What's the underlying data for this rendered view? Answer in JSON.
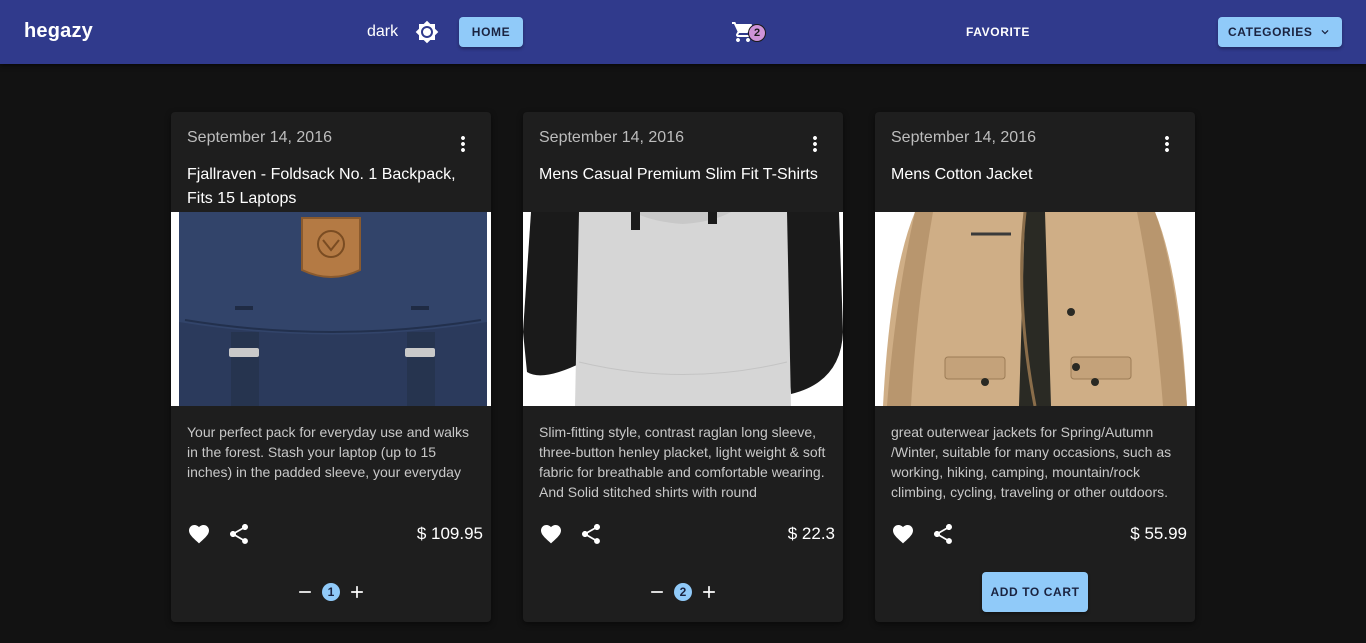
{
  "header": {
    "brand": "hegazy",
    "mode_label": "dark",
    "home_label": "HOME",
    "cart_count": "2",
    "favorite_label": "FAVORITE",
    "categories_label": "CATEGORIES"
  },
  "products": [
    {
      "date": "September 14, 2016",
      "title": "Fjallraven - Foldsack No. 1 Backpack, Fits 15 Laptops",
      "description": "Your perfect pack for everyday use and walks in the forest. Stash your laptop (up to 15 inches) in the padded sleeve, your everyday",
      "price": "$ 109.95",
      "quantity": "1"
    },
    {
      "date": "September 14, 2016",
      "title": "Mens Casual Premium Slim Fit T-Shirts",
      "description": "Slim-fitting style, contrast raglan long sleeve, three-button henley placket, light weight & soft fabric for breathable and comfortable wearing. And Solid stitched shirts with round",
      "price": "$ 22.3",
      "quantity": "2"
    },
    {
      "date": "September 14, 2016",
      "title": "Mens Cotton Jacket",
      "description": "great outerwear jackets for Spring/Autumn /Winter, suitable for many occasions, such as working, hiking, camping, mountain/rock climbing, cycling, traveling or other outdoors.",
      "price": "$ 55.99",
      "add_to_cart_label": "ADD TO CART"
    }
  ],
  "colors": {
    "appbar": "#303a8c",
    "accent": "#90caf9",
    "badge": "#ce93d8",
    "card": "#1e1e1e",
    "background": "#121212"
  },
  "icons": [
    "brightness-icon",
    "cart-icon",
    "chevron-down-icon",
    "more-vert-icon",
    "heart-icon",
    "share-icon",
    "minus-icon",
    "plus-icon"
  ]
}
